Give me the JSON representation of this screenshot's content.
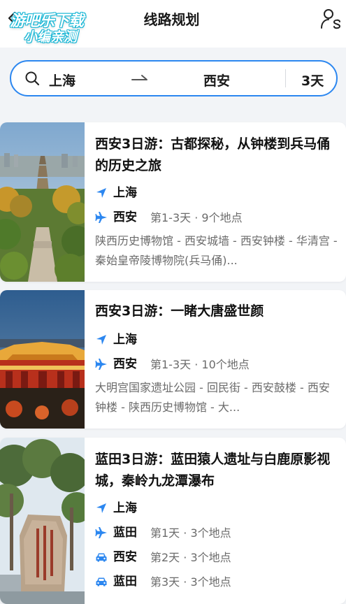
{
  "header": {
    "back_icon": "chevron-left-icon",
    "watermark_line1": "游吧乐下载",
    "watermark_line2": "小编亲测",
    "title": "线路规划",
    "profile_icon": "profile-switch-icon"
  },
  "search": {
    "icon": "search-icon",
    "from": "上海",
    "swap_icon": "arrow-right-icon",
    "to": "西安",
    "days": "3天",
    "accent": "#2c87f0"
  },
  "routes": [
    {
      "title": "西安3日游：古都探秘，从钟楼到兵马俑的历史之旅",
      "origin": "上海",
      "stops": [
        {
          "city": "西安",
          "meta": "第1-3天 · 9个地点",
          "icon": "plane-icon"
        }
      ],
      "places": "陕西历史博物馆 - 西安城墙 - 西安钟楼 - 华清宫 - 秦始皇帝陵博物院(兵马俑)..."
    },
    {
      "title": "西安3日游：一睹大唐盛世颜",
      "origin": "上海",
      "stops": [
        {
          "city": "西安",
          "meta": "第1-3天 · 10个地点",
          "icon": "plane-icon"
        }
      ],
      "places": "大明宫国家遗址公园 - 回民街 - 西安鼓楼 - 西安钟楼 - 陕西历史博物馆 - 大..."
    },
    {
      "title": "蓝田3日游：蓝田猿人遗址与白鹿原影视城，秦岭九龙潭瀑布",
      "origin": "上海",
      "stops": [
        {
          "city": "蓝田",
          "meta": "第1天 · 3个地点",
          "icon": "plane-icon"
        },
        {
          "city": "西安",
          "meta": "第2天 · 3个地点",
          "icon": "car-icon"
        },
        {
          "city": "蓝田",
          "meta": "第3天 · 3个地点",
          "icon": "car-icon"
        }
      ]
    }
  ]
}
